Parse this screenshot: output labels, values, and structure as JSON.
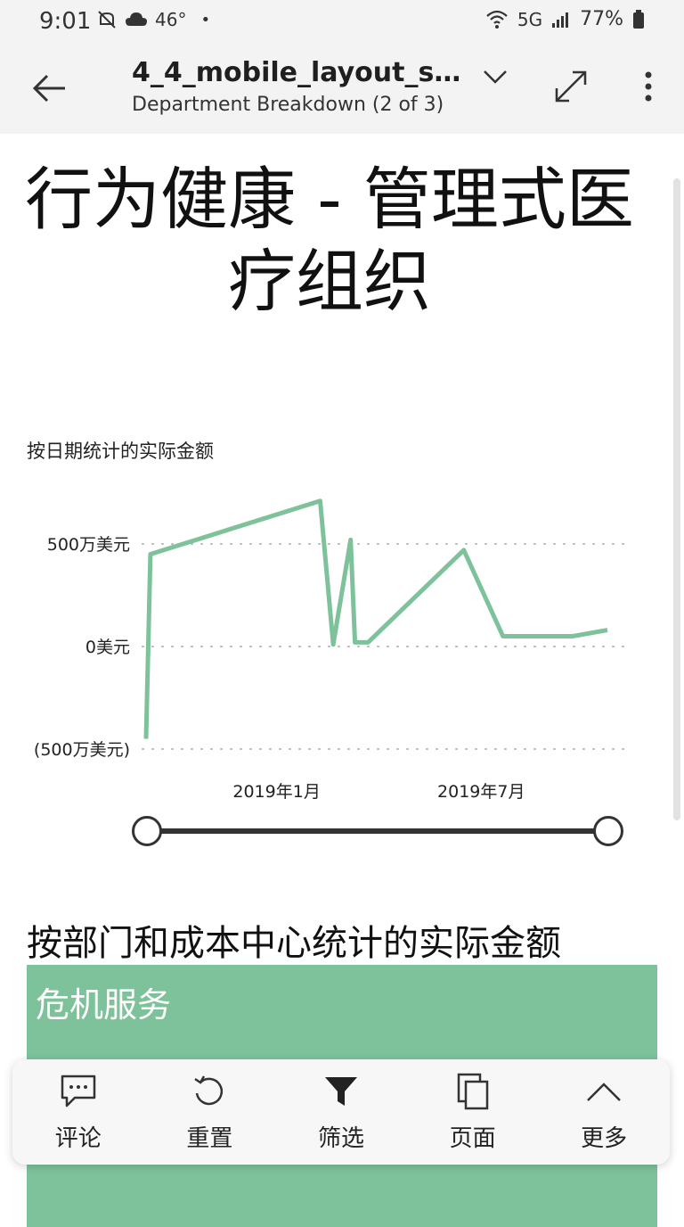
{
  "status_bar": {
    "time": "9:01",
    "temperature": "46°",
    "dot": "•",
    "network": "5G",
    "battery": "77%"
  },
  "app_bar": {
    "title": "4_4_mobile_layout_sol...",
    "subtitle": "Department Breakdown (2 of 3)"
  },
  "page_title": "行为健康 - 管理式医疗组织",
  "chart_data": {
    "type": "line",
    "title": "按日期统计的实际金额",
    "y_ticks": [
      "500万美元",
      "0美元",
      "(500万美元)"
    ],
    "x_ticks": [
      "2019年1月",
      "2019年7月"
    ],
    "ylim": [
      -5,
      7
    ],
    "y_unit": "百万美元",
    "series": [
      {
        "points": [
          [
            0,
            -4.5
          ],
          [
            1,
            4.5
          ],
          [
            40,
            7.1
          ],
          [
            43,
            0.1
          ],
          [
            47,
            5.2
          ],
          [
            48,
            0.2
          ],
          [
            51,
            0.2
          ],
          [
            73,
            4.7
          ],
          [
            82,
            0.5
          ],
          [
            98,
            0.5
          ],
          [
            106,
            0.8
          ]
        ]
      }
    ],
    "x_tick_positions": [
      30,
      77
    ],
    "line_color": "#7dc29a"
  },
  "section2": {
    "title": "按部门和成本中心统计的实际金额",
    "first_category": "危机服务",
    "block_color": "#7dc29a"
  },
  "bottom_bar": {
    "comment": "评论",
    "reset": "重置",
    "filter": "筛选",
    "pages": "页面",
    "more": "更多"
  },
  "icons": {
    "back": "arrow-left-icon",
    "dropdown": "chevron-down-icon",
    "expand": "expand-icon",
    "overflow": "more-vertical-icon"
  }
}
